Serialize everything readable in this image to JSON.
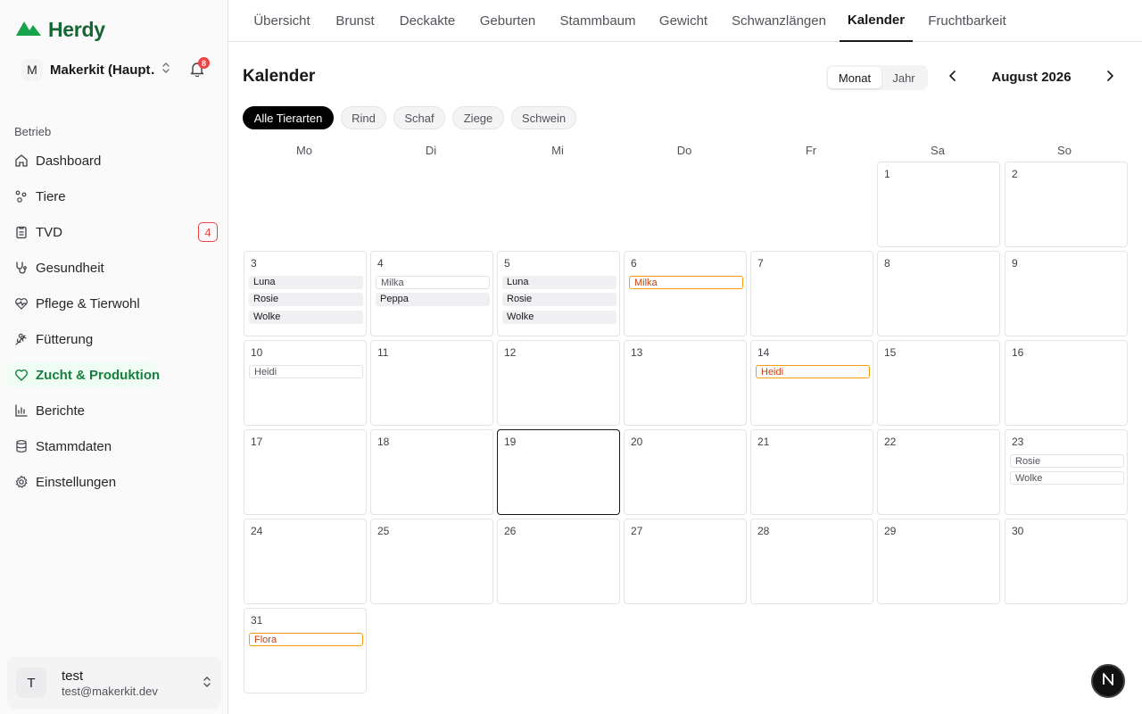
{
  "app": {
    "name": "Herdy"
  },
  "org": {
    "avatar": "M",
    "name": "Makerkit (Haupt…",
    "notifications": "8"
  },
  "sidebar": {
    "section_label": "Betrieb",
    "items": [
      {
        "label": "Dashboard",
        "icon": "home-icon"
      },
      {
        "label": "Tiere",
        "icon": "paw-icon"
      },
      {
        "label": "TVD",
        "icon": "clipboard-icon",
        "badge": "4"
      },
      {
        "label": "Gesundheit",
        "icon": "stethoscope-icon"
      },
      {
        "label": "Pflege & Tierwohl",
        "icon": "heart-pulse-icon"
      },
      {
        "label": "Fütterung",
        "icon": "wheat-icon"
      },
      {
        "label": "Zucht & Produktion",
        "icon": "heart-icon",
        "active": true
      },
      {
        "label": "Berichte",
        "icon": "bar-chart-icon"
      },
      {
        "label": "Stammdaten",
        "icon": "database-icon"
      },
      {
        "label": "Einstellungen",
        "icon": "gear-icon"
      }
    ]
  },
  "user": {
    "avatar": "T",
    "name": "test",
    "email": "test@makerkit.dev"
  },
  "tabs": [
    "Übersicht",
    "Brunst",
    "Deckakte",
    "Geburten",
    "Stammbaum",
    "Gewicht",
    "Schwanzlängen",
    "Kalender",
    "Fruchtbarkeit"
  ],
  "active_tab": "Kalender",
  "calendar": {
    "title": "Kalender",
    "view_toggle": {
      "month": "Monat",
      "year": "Jahr",
      "selected": "Monat"
    },
    "month_label": "August 2026",
    "filters": [
      "Alle Tierarten",
      "Rind",
      "Schaf",
      "Ziege",
      "Schwein"
    ],
    "active_filter": "Alle Tierarten",
    "weekdays": [
      "Mo",
      "Di",
      "Mi",
      "Do",
      "Fr",
      "Sa",
      "So"
    ],
    "today": 19,
    "days": [
      {
        "day": "1"
      },
      {
        "day": "2"
      },
      {
        "day": "3",
        "events": [
          {
            "name": "Luna",
            "style": "solid"
          },
          {
            "name": "Rosie",
            "style": "solid"
          },
          {
            "name": "Wolke",
            "style": "solid"
          }
        ]
      },
      {
        "day": "4",
        "events": [
          {
            "name": "Milka",
            "style": "outline"
          },
          {
            "name": "Peppa",
            "style": "solid"
          }
        ]
      },
      {
        "day": "5",
        "events": [
          {
            "name": "Luna",
            "style": "solid"
          },
          {
            "name": "Rosie",
            "style": "solid"
          },
          {
            "name": "Wolke",
            "style": "solid"
          }
        ]
      },
      {
        "day": "6",
        "events": [
          {
            "name": "Milka",
            "style": "orange"
          }
        ]
      },
      {
        "day": "7"
      },
      {
        "day": "8"
      },
      {
        "day": "9"
      },
      {
        "day": "10",
        "events": [
          {
            "name": "Heidi",
            "style": "outline"
          }
        ]
      },
      {
        "day": "11"
      },
      {
        "day": "12"
      },
      {
        "day": "13"
      },
      {
        "day": "14",
        "events": [
          {
            "name": "Heidi",
            "style": "orange"
          }
        ]
      },
      {
        "day": "15"
      },
      {
        "day": "16"
      },
      {
        "day": "17"
      },
      {
        "day": "18"
      },
      {
        "day": "19"
      },
      {
        "day": "20"
      },
      {
        "day": "21"
      },
      {
        "day": "22"
      },
      {
        "day": "23",
        "events": [
          {
            "name": "Rosie",
            "style": "outline"
          },
          {
            "name": "Wolke",
            "style": "outline"
          }
        ]
      },
      {
        "day": "24"
      },
      {
        "day": "25"
      },
      {
        "day": "26"
      },
      {
        "day": "27"
      },
      {
        "day": "28"
      },
      {
        "day": "29"
      },
      {
        "day": "30"
      },
      {
        "day": "31",
        "events": [
          {
            "name": "Flora",
            "style": "orange"
          }
        ]
      }
    ]
  },
  "fab": {
    "label": "N"
  },
  "colors": {
    "brand": "#166534",
    "accent_orange": "#f59e0b",
    "alert": "#ef4444"
  }
}
